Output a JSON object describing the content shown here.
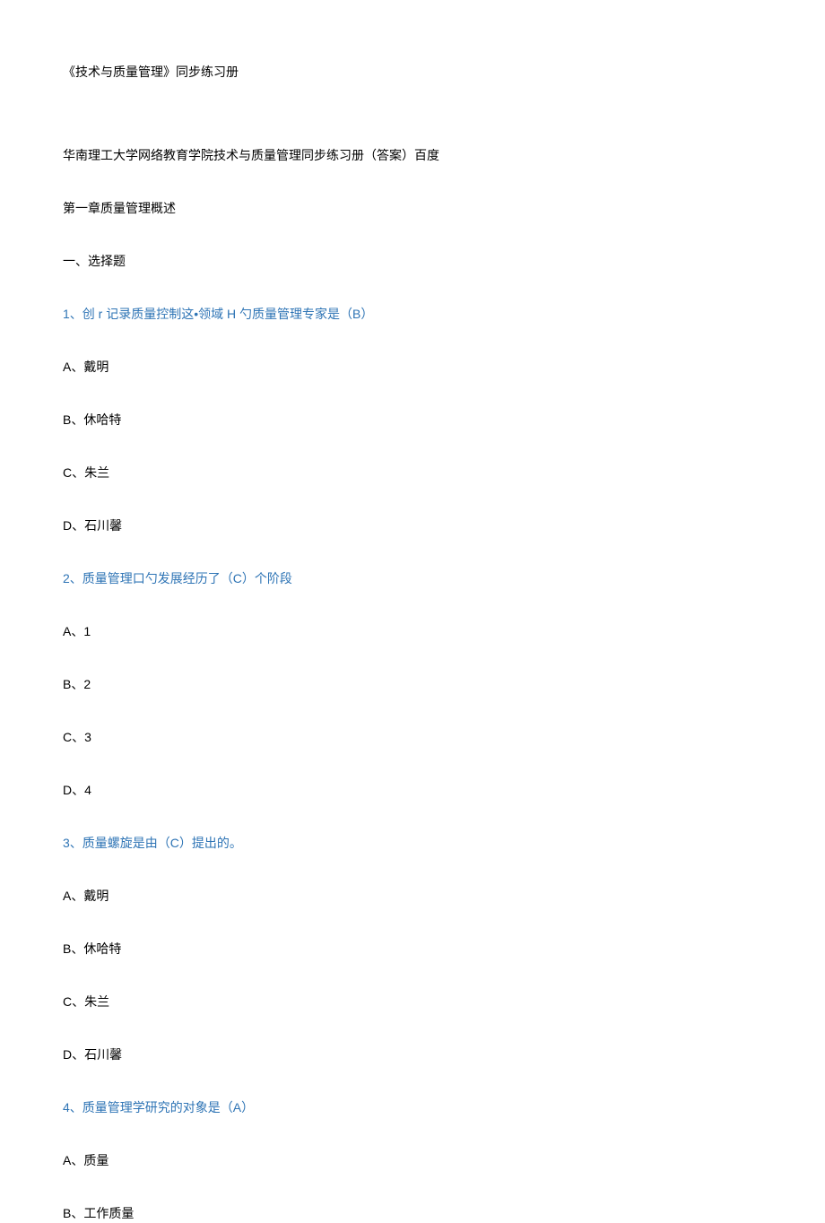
{
  "title": "《技术与质量管理》同步练习册",
  "subtitle": "华南理工大学网络教育学院技术与质量管理同步练习册（答案）百度",
  "chapter": "第一章质量管理概述",
  "section": "一、选择题",
  "questions": [
    {
      "text": "1、创 r 记录质量控制这•领域 H 勺质量管理专家是（B）",
      "options": [
        "A、戴明",
        "B、休哈特",
        "C、朱兰",
        "D、石川馨"
      ]
    },
    {
      "text": "2、质量管理口勺发展经历了（C）个阶段",
      "options": [
        "A、1",
        "B、2",
        "C、3",
        "D、4"
      ]
    },
    {
      "text": "3、质量螺旋是由（C）提出的。",
      "options": [
        "A、戴明",
        "B、休哈特",
        "C、朱兰",
        "D、石川馨"
      ]
    },
    {
      "text": "4、质量管理学研究的对象是（A）",
      "options": [
        "A、质量",
        "B、工作质量"
      ]
    }
  ]
}
